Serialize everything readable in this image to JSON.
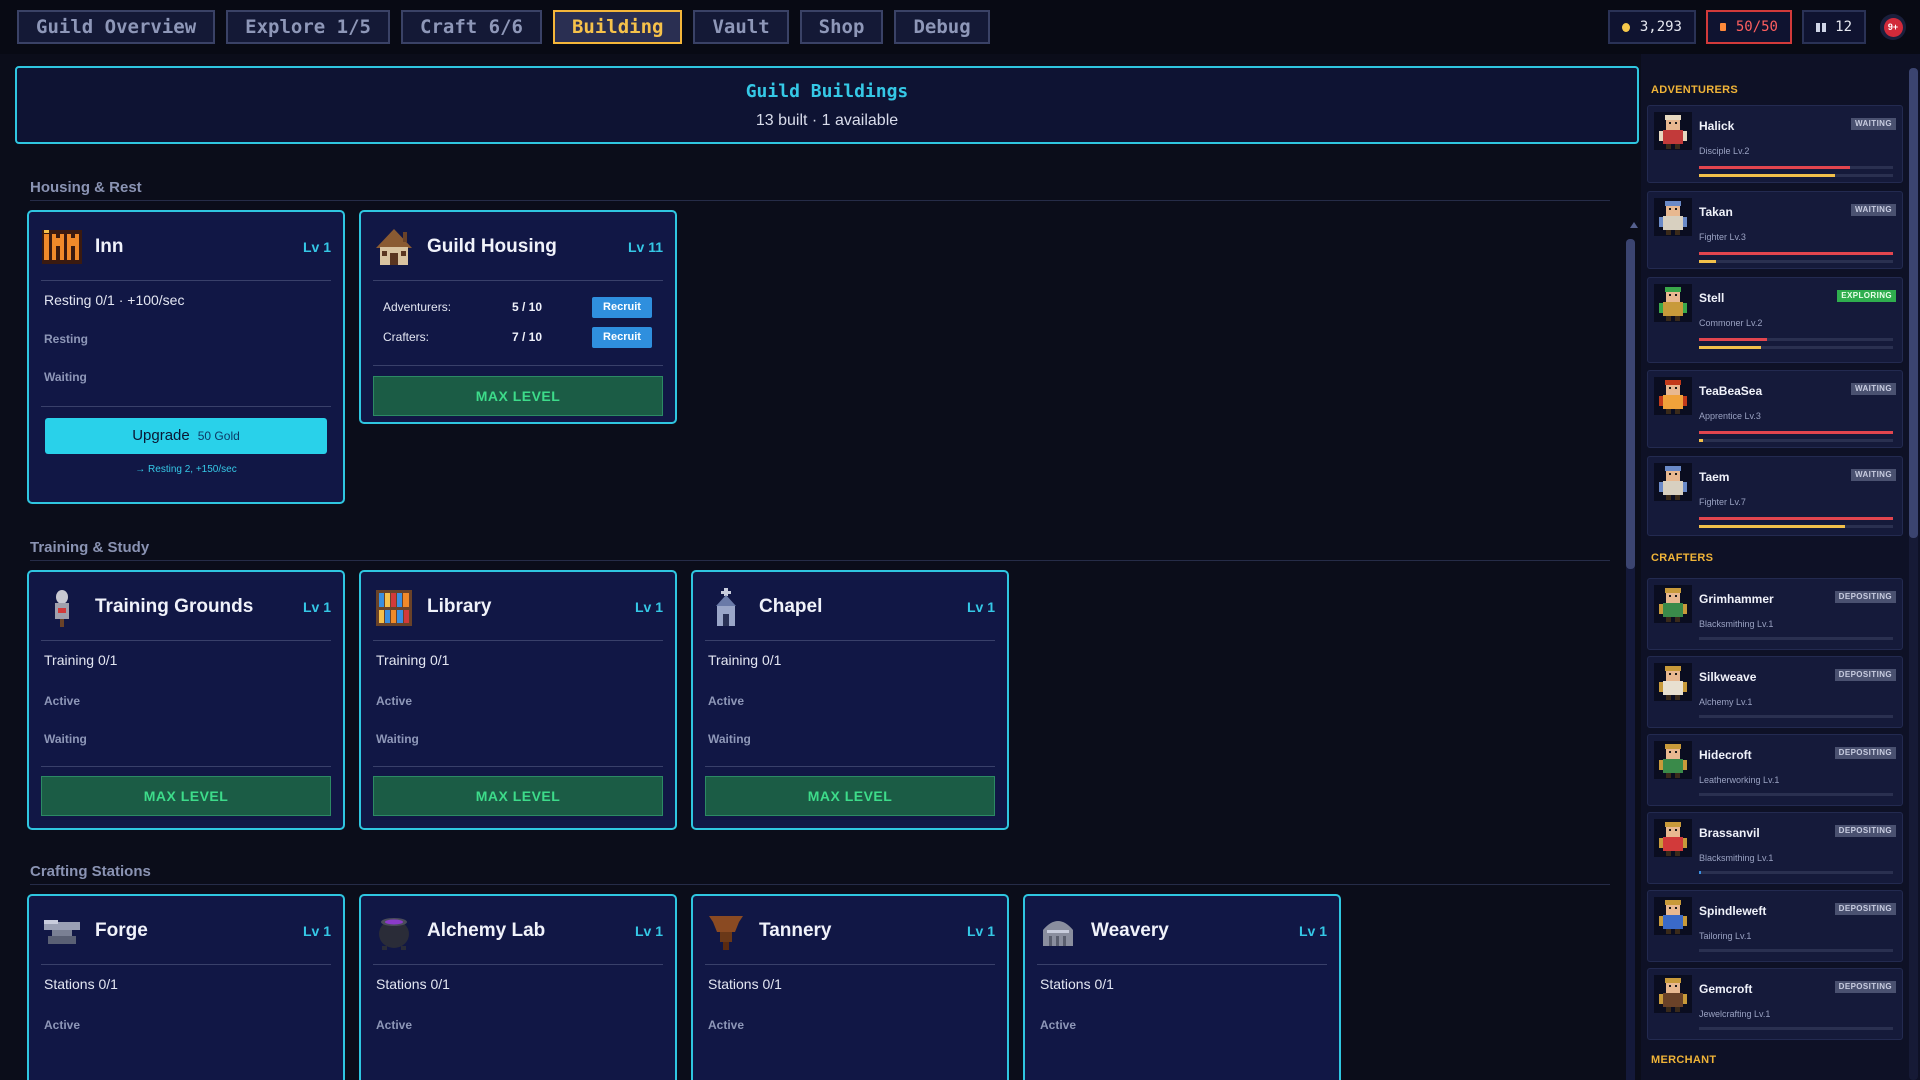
{
  "nav": {
    "tabs": [
      {
        "label": "Guild Overview"
      },
      {
        "label": "Explore 1/5"
      },
      {
        "label": "Craft 6/6"
      },
      {
        "label": "Building"
      },
      {
        "label": "Vault"
      },
      {
        "label": "Shop"
      },
      {
        "label": "Debug"
      }
    ],
    "active_tab": "Building"
  },
  "resources": {
    "gold": "3,293",
    "energy": "50/50",
    "people": "12",
    "notifications": "9+"
  },
  "header": {
    "title": "Guild Buildings",
    "subtitle": "13 built · 1 available"
  },
  "sections": {
    "housing": "Housing & Rest",
    "training": "Training & Study",
    "crafting": "Crafting Stations"
  },
  "buildings": {
    "inn": {
      "name": "Inn",
      "level": "Lv 1",
      "line1": "Resting 0/1 · +100/sec",
      "stat1": "Resting",
      "stat2": "Waiting",
      "upgrade_label": "Upgrade",
      "upgrade_cost": "50 Gold",
      "upgrade_note": "→ Resting 2, +150/sec",
      "icon": "inn-sign-icon"
    },
    "guild_housing": {
      "name": "Guild Housing",
      "level": "Lv 11",
      "adventurers_label": "Adventurers:",
      "adventurers_value": "5 / 10",
      "crafters_label": "Crafters:",
      "crafters_value": "7 / 10",
      "recruit_label": "Recruit",
      "max_label": "MAX LEVEL",
      "icon": "house-icon"
    },
    "training_grounds": {
      "name": "Training Grounds",
      "level": "Lv 1",
      "line1": "Training 0/1",
      "stat1": "Active",
      "stat2": "Waiting",
      "max_label": "MAX LEVEL",
      "icon": "dummy-icon"
    },
    "library": {
      "name": "Library",
      "level": "Lv 1",
      "line1": "Training 0/1",
      "stat1": "Active",
      "stat2": "Waiting",
      "max_label": "MAX LEVEL",
      "icon": "bookshelf-icon"
    },
    "chapel": {
      "name": "Chapel",
      "level": "Lv 1",
      "line1": "Training 0/1",
      "stat1": "Active",
      "stat2": "Waiting",
      "max_label": "MAX LEVEL",
      "icon": "chapel-icon"
    },
    "forge": {
      "name": "Forge",
      "level": "Lv 1",
      "line1": "Stations 0/1",
      "stat1": "Active",
      "icon": "anvil-icon"
    },
    "alchemy_lab": {
      "name": "Alchemy Lab",
      "level": "Lv 1",
      "line1": "Stations 0/1",
      "stat1": "Active",
      "icon": "cauldron-icon"
    },
    "tannery": {
      "name": "Tannery",
      "level": "Lv 1",
      "line1": "Stations 0/1",
      "stat1": "Active",
      "icon": "hide-rack-icon"
    },
    "weavery": {
      "name": "Weavery",
      "level": "Lv 1",
      "line1": "Stations 0/1",
      "stat1": "Active",
      "icon": "loom-icon"
    }
  },
  "sidebar": {
    "adventurers_title": "ADVENTURERS",
    "crafters_title": "CRAFTERS",
    "merchant_title": "MERCHANT",
    "adventurers": [
      {
        "name": "Halick",
        "class": "Disciple Lv.2",
        "status": "WAITING",
        "hp": 0.78,
        "xp": 0.7
      },
      {
        "name": "Takan",
        "class": "Fighter Lv.3",
        "status": "WAITING",
        "hp": 1.0,
        "xp": 0.09
      },
      {
        "name": "Stell",
        "class": "Commoner Lv.2",
        "status": "EXPLORING",
        "hp": 0.35,
        "xp": 0.32
      },
      {
        "name": "TeaBeaSea",
        "class": "Apprentice Lv.3",
        "status": "WAITING",
        "hp": 1.0,
        "xp": 0.02
      },
      {
        "name": "Taem",
        "class": "Fighter Lv.7",
        "status": "WAITING",
        "hp": 1.0,
        "xp": 0.75
      }
    ],
    "crafters": [
      {
        "name": "Grimhammer",
        "class": "Blacksmithing Lv.1",
        "status": "DEPOSITING",
        "progress": 0.0
      },
      {
        "name": "Silkweave",
        "class": "Alchemy Lv.1",
        "status": "DEPOSITING",
        "progress": 0.0
      },
      {
        "name": "Hidecroft",
        "class": "Leatherworking Lv.1",
        "status": "DEPOSITING",
        "progress": 0.0
      },
      {
        "name": "Brassanvil",
        "class": "Blacksmithing Lv.1",
        "status": "DEPOSITING",
        "progress": 0.01
      },
      {
        "name": "Spindleweft",
        "class": "Tailoring Lv.1",
        "status": "DEPOSITING",
        "progress": 0.0
      },
      {
        "name": "Gemcroft",
        "class": "Jewelcrafting Lv.1",
        "status": "DEPOSITING",
        "progress": 0.0
      }
    ]
  }
}
